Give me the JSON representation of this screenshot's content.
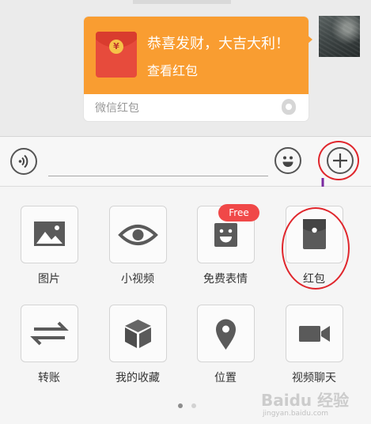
{
  "chat": {
    "red_packet_message": {
      "greeting": "恭喜发财，大吉大利！",
      "action": "查看红包",
      "footer_label": "微信红包",
      "coin_symbol": "¥",
      "bubble_color": "#f99d31"
    }
  },
  "input_bar": {
    "voice_icon": "voice-icon",
    "emoji_icon": "emoji-icon",
    "more_icon": "plus-icon"
  },
  "panel": {
    "items": [
      {
        "label": "图片",
        "icon": "image-icon"
      },
      {
        "label": "小视频",
        "icon": "eye-icon"
      },
      {
        "label": "免费表情",
        "icon": "sticker-icon",
        "badge": "Free"
      },
      {
        "label": "红包",
        "icon": "red-packet-icon"
      },
      {
        "label": "转账",
        "icon": "transfer-icon"
      },
      {
        "label": "我的收藏",
        "icon": "favorites-cube-icon"
      },
      {
        "label": "位置",
        "icon": "location-pin-icon"
      },
      {
        "label": "视频聊天",
        "icon": "video-camera-icon"
      }
    ],
    "page_count": 2,
    "current_page": 1
  },
  "annotation_color": "#e0262c",
  "arrow_color": "#7a2aa0",
  "watermark": {
    "brand": "Baidu 经验",
    "url": "jingyan.baidu.com"
  }
}
